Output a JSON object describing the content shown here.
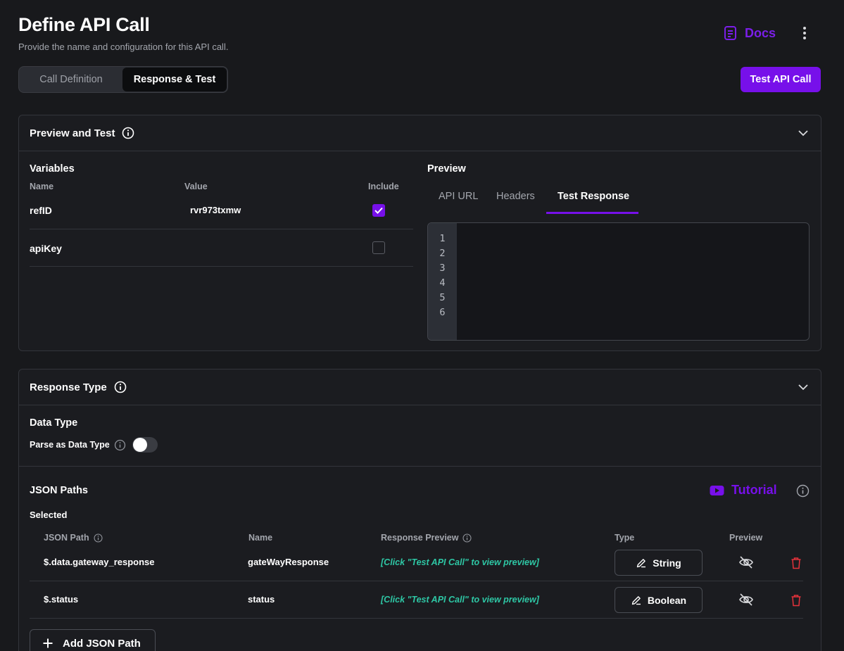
{
  "header": {
    "title": "Define API Call",
    "subtitle": "Provide the name and configuration for this API call.",
    "docs_label": "Docs"
  },
  "tabs": {
    "items": [
      "Call Definition",
      "Response & Test"
    ],
    "active": "Response & Test"
  },
  "test_button_label": "Test API Call",
  "preview_panel": {
    "title": "Preview and Test",
    "variables": {
      "title": "Variables",
      "columns": {
        "name": "Name",
        "value": "Value",
        "include": "Include"
      },
      "rows": [
        {
          "name": "refID",
          "value": "rvr973txmw",
          "include": true
        },
        {
          "name": "apiKey",
          "value": "",
          "include": false
        }
      ]
    },
    "preview": {
      "title": "Preview",
      "tabs": [
        "API URL",
        "Headers",
        "Test Response"
      ],
      "active_tab": "Test Response",
      "line_numbers": [
        "1",
        "2",
        "3",
        "4",
        "5",
        "6"
      ]
    }
  },
  "response_panel": {
    "title": "Response Type",
    "data_type": {
      "title": "Data Type",
      "parse_label": "Parse as Data Type",
      "parse_enabled": false
    },
    "json_paths": {
      "title": "JSON Paths",
      "tutorial_label": "Tutorial",
      "selected_label": "Selected",
      "columns": {
        "path": "JSON Path",
        "name": "Name",
        "response_preview": "Response Preview",
        "type": "Type",
        "preview": "Preview"
      },
      "rows": [
        {
          "path": "$.data.gateway_response",
          "name": "gateWayResponse",
          "preview_text": "[Click \"Test API Call\" to view preview]",
          "type": "String"
        },
        {
          "path": "$.status",
          "name": "status",
          "preview_text": "[Click \"Test API Call\" to view preview]",
          "type": "Boolean"
        }
      ],
      "add_label": "Add JSON Path"
    }
  },
  "colors": {
    "accent": "#7710ea",
    "background": "#18191c",
    "panel": "#1b1c20",
    "teal_text": "#2ec7a5",
    "delete": "#e5323b"
  },
  "icons": [
    "docs-icon",
    "more-vertical-icon",
    "info-icon",
    "chevron-down-icon",
    "check-icon",
    "youtube-icon",
    "pencil-icon",
    "eye-off-icon",
    "trash-icon",
    "plus-icon"
  ]
}
